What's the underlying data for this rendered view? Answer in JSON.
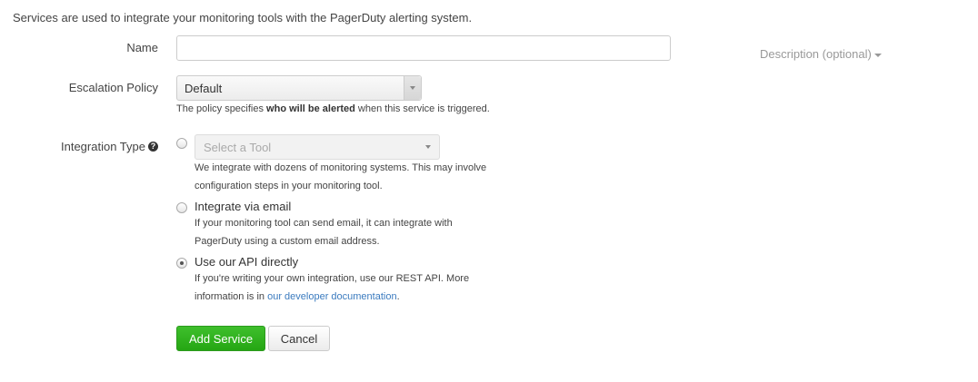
{
  "intro": "Services are used to integrate your monitoring tools with the PagerDuty alerting system.",
  "name_field": {
    "label": "Name",
    "value": "",
    "placeholder": ""
  },
  "description_toggle": "Description (optional)",
  "escalation": {
    "label": "Escalation Policy",
    "selected": "Default",
    "help_pre": "The policy specifies ",
    "help_bold": "who will be alerted",
    "help_post": " when this service is triggered."
  },
  "integration": {
    "label": "Integration Type",
    "help_icon": "?",
    "selected_option": "api",
    "tool": {
      "placeholder": "Select a Tool",
      "desc_line1": "We integrate with dozens of monitoring systems. This may involve",
      "desc_line2": "configuration steps in your monitoring tool."
    },
    "email": {
      "title": "Integrate via email",
      "desc_line1": "If your monitoring tool can send email, it can integrate with",
      "desc_line2": "PagerDuty using a custom email address."
    },
    "api": {
      "title": "Use our API directly",
      "desc_line1": "If you're writing your own integration, use our REST API. More",
      "desc_line2_pre": "information is in ",
      "desc_line2_link": "our developer documentation",
      "desc_line2_post": "."
    }
  },
  "buttons": {
    "add": "Add Service",
    "cancel": "Cancel"
  },
  "colors": {
    "primary_button": "#25a613",
    "link": "#3b7bbf"
  }
}
